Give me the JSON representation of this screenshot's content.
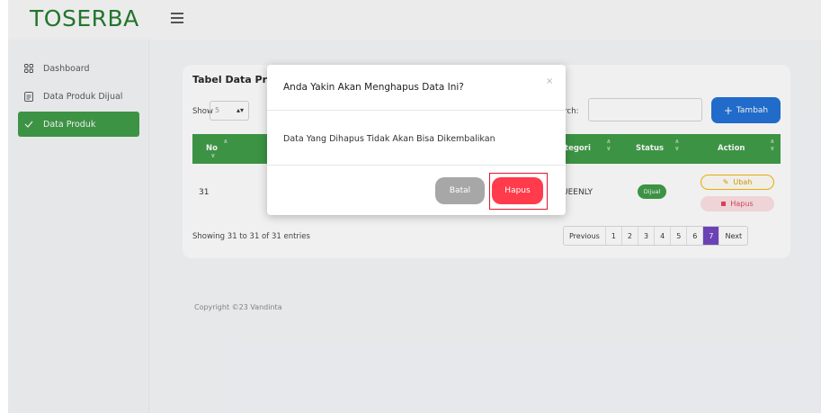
{
  "brand": "TOSERBA",
  "sidebar": {
    "items": [
      {
        "label": "Dashboard",
        "icon": "grid-icon",
        "active": false
      },
      {
        "label": "Data Produk Dijual",
        "icon": "document-icon",
        "active": false
      },
      {
        "label": "Data Produk",
        "icon": "check-icon",
        "active": true
      }
    ]
  },
  "card": {
    "title": "Tabel Data Pro",
    "show_label": "Show",
    "show_value": "5",
    "search_label": "arch:",
    "add_button": "Tambah",
    "columns": {
      "no": "No",
      "kategori": "tegori",
      "status": "Status",
      "action": "Action"
    },
    "row": {
      "no": "31",
      "kategori": "UEENLY",
      "status": "Dijual",
      "edit": "Ubah",
      "delete": "Hapus"
    },
    "showing": "Showing 31 to 31 of 31 entries",
    "pagination": {
      "previous": "Previous",
      "pages": [
        "1",
        "2",
        "3",
        "4",
        "5",
        "6",
        "7"
      ],
      "active_page": "7",
      "next": "Next"
    }
  },
  "footer": {
    "copyright": "Copyright ©23 Vandinta"
  },
  "modal": {
    "title": "Anda Yakin Akan Menghapus Data Ini?",
    "close": "×",
    "body": "Data Yang Dihapus Tidak Akan Bisa Dikembalikan",
    "cancel": "Batal",
    "confirm": "Hapus"
  },
  "colors": {
    "brand_green": "#1f7a2c",
    "accent_green": "#3c9b45",
    "primary_blue": "#1f6fd6",
    "danger_red": "#ff3b4c",
    "pager_active": "#6f42c1"
  }
}
